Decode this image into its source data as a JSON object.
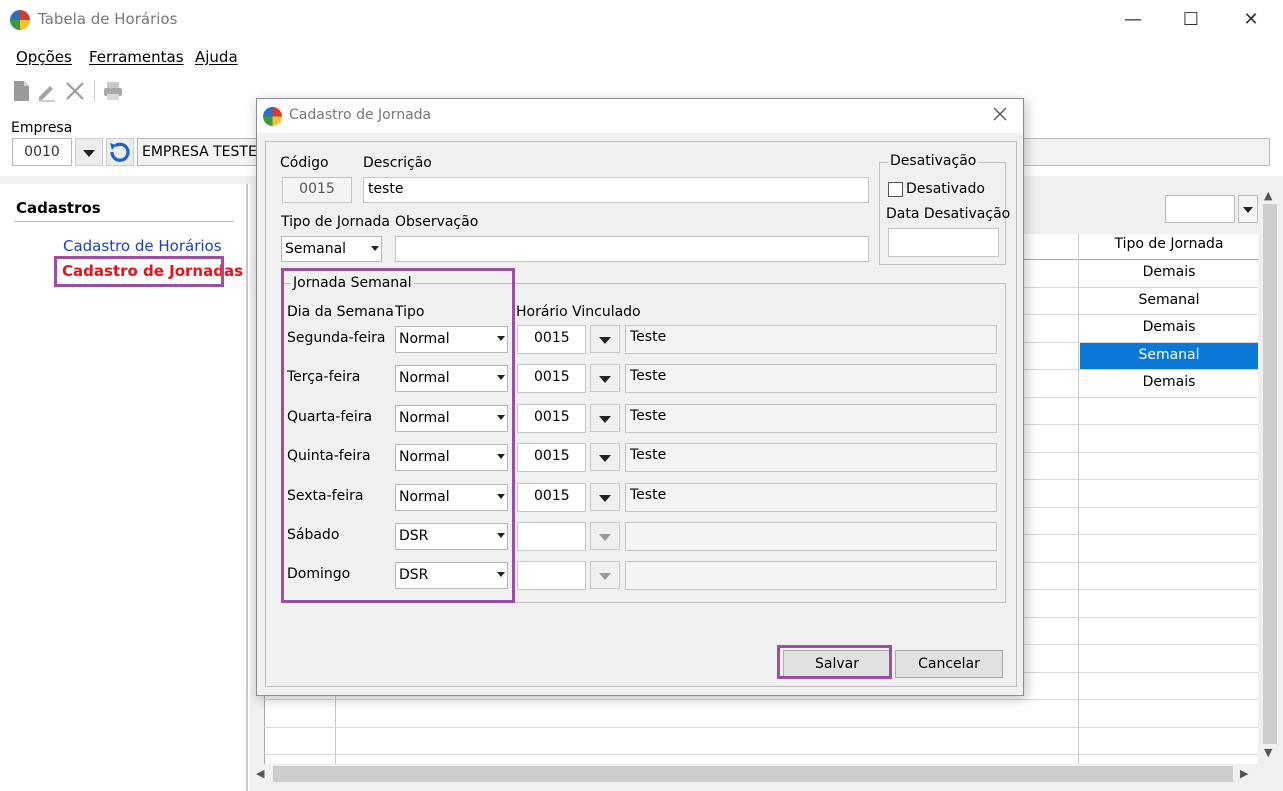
{
  "main_window": {
    "title": "Tabela de Horários",
    "controls": {
      "minimize": "—",
      "maximize": "☐",
      "close": "✕"
    }
  },
  "menu": [
    {
      "label": "Opções"
    },
    {
      "label": "Ferramentas"
    },
    {
      "label": "Ajuda"
    }
  ],
  "toolbar": {
    "icons": [
      "new-document-icon",
      "edit-pencil-icon",
      "delete-x-icon",
      "print-icon"
    ]
  },
  "empresa": {
    "label": "Empresa",
    "code": "0010",
    "name": "EMPRESA TESTE"
  },
  "sidebar": {
    "title": "Cadastros",
    "items": [
      {
        "label": "Cadastro de Horários",
        "color": "#1b3fc8"
      },
      {
        "label": "Cadastro de Jornadas",
        "color": "#e8121c"
      }
    ]
  },
  "grid": {
    "column_header": "Tipo de Jornada",
    "rows": [
      {
        "tipo": "Demais",
        "selected": false
      },
      {
        "tipo": "Semanal",
        "selected": false
      },
      {
        "tipo": "Demais",
        "selected": false
      },
      {
        "tipo": "Semanal",
        "selected": true
      },
      {
        "tipo": "Demais",
        "selected": false
      }
    ]
  },
  "dialog": {
    "title": "Cadastro de Jornada",
    "codigo": {
      "label": "Código",
      "value": "0015"
    },
    "descricao": {
      "label": "Descrição",
      "value": "teste"
    },
    "tipo_jornada": {
      "label": "Tipo de Jornada",
      "value": "Semanal"
    },
    "observacao": {
      "label": "Observação",
      "value": ""
    },
    "desativacao": {
      "group_title": "Desativação",
      "checkbox_label": "Desativado",
      "checked": false,
      "data_label": "Data Desativação",
      "data_value": ""
    },
    "jornada_semanal": {
      "group_title": "Jornada Semanal",
      "col_dia": "Dia da Semana",
      "col_tipo": "Tipo",
      "col_horario": "Horário Vinculado",
      "days": [
        {
          "dia": "Segunda-feira",
          "tipo": "Normal",
          "codigo": "0015",
          "horario": "Teste",
          "enabled": true
        },
        {
          "dia": "Terça-feira",
          "tipo": "Normal",
          "codigo": "0015",
          "horario": "Teste",
          "enabled": true
        },
        {
          "dia": "Quarta-feira",
          "tipo": "Normal",
          "codigo": "0015",
          "horario": "Teste",
          "enabled": true
        },
        {
          "dia": "Quinta-feira",
          "tipo": "Normal",
          "codigo": "0015",
          "horario": "Teste",
          "enabled": true
        },
        {
          "dia": "Sexta-feira",
          "tipo": "Normal",
          "codigo": "0015",
          "horario": "Teste",
          "enabled": true
        },
        {
          "dia": "Sábado",
          "tipo": "DSR",
          "codigo": "",
          "horario": "",
          "enabled": false
        },
        {
          "dia": "Domingo",
          "tipo": "DSR",
          "codigo": "",
          "horario": "",
          "enabled": false
        }
      ]
    },
    "buttons": {
      "salvar": "Salvar",
      "cancelar": "Cancelar"
    }
  },
  "colors": {
    "highlight": "#9b4fa3",
    "selection": "#0a78d7"
  }
}
